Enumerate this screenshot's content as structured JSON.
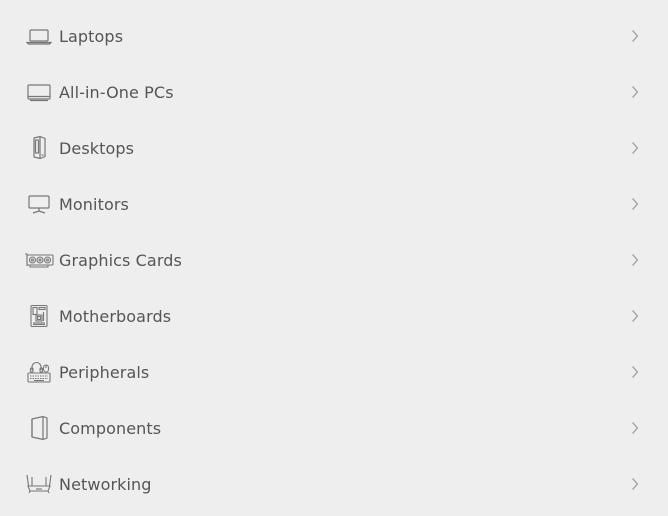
{
  "menu": {
    "items": [
      {
        "label": "Laptops",
        "icon": "laptop-icon"
      },
      {
        "label": "All-in-One PCs",
        "icon": "all-in-one-pc-icon"
      },
      {
        "label": "Desktops",
        "icon": "desktop-tower-icon"
      },
      {
        "label": "Monitors",
        "icon": "monitor-icon"
      },
      {
        "label": "Graphics Cards",
        "icon": "graphics-card-icon"
      },
      {
        "label": "Motherboards",
        "icon": "motherboard-icon"
      },
      {
        "label": "Peripherals",
        "icon": "peripherals-icon"
      },
      {
        "label": "Components",
        "icon": "components-icon"
      },
      {
        "label": "Networking",
        "icon": "router-icon"
      }
    ]
  },
  "colors": {
    "background": "#eeeeee",
    "text": "#555555",
    "icon": "#777777",
    "chevron": "#999999"
  }
}
